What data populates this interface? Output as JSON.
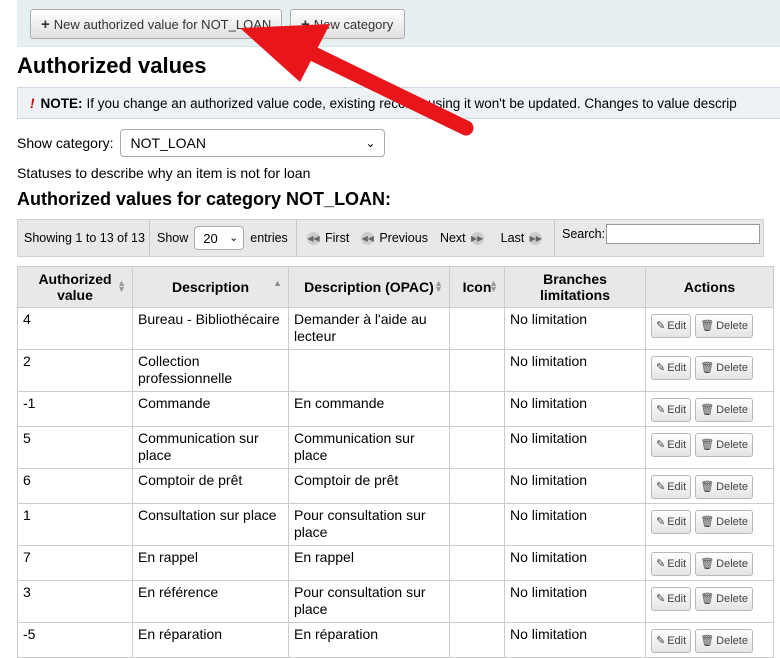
{
  "toolbar": {
    "new_value_label": "New authorized value for NOT_LOAN",
    "new_category_label": "New category"
  },
  "page_title": "Authorized values",
  "note": {
    "prefix": "NOTE:",
    "text": "If you change an authorized value code, existing records using it won't be updated. Changes to value descrip"
  },
  "show_category": {
    "label": "Show category:",
    "value": "NOT_LOAN"
  },
  "category_description": "Statuses to describe why an item is not for loan",
  "section_title": "Authorized values for category NOT_LOAN:",
  "datatable": {
    "info": "Showing 1 to 13 of 13",
    "show_label": "Show",
    "page_length": "20",
    "entries_label": "entries",
    "first": "First",
    "previous": "Previous",
    "next": "Next",
    "last": "Last",
    "search_label": "Search:"
  },
  "columns": [
    "Authorized value",
    "Description",
    "Description (OPAC)",
    "Icon",
    "Branches limitations",
    "Actions"
  ],
  "action_labels": {
    "edit": "Edit",
    "delete": "Delete"
  },
  "rows": [
    {
      "code": "4",
      "desc": "Bureau - Bibliothécaire",
      "opac": "Demander à l'aide au lecteur",
      "branches": "No limitation"
    },
    {
      "code": "2",
      "desc": "Collection professionnelle",
      "opac": "",
      "branches": "No limitation"
    },
    {
      "code": "-1",
      "desc": "Commande",
      "opac": "En commande",
      "branches": "No limitation"
    },
    {
      "code": "5",
      "desc": "Communication sur place",
      "opac": "Communication sur place",
      "branches": "No limitation"
    },
    {
      "code": "6",
      "desc": "Comptoir de prêt",
      "opac": "Comptoir de prêt",
      "branches": "No limitation"
    },
    {
      "code": "1",
      "desc": "Consultation sur place",
      "opac": "Pour consultation sur place",
      "branches": "No limitation"
    },
    {
      "code": "7",
      "desc": "En rappel",
      "opac": "En rappel",
      "branches": "No limitation"
    },
    {
      "code": "3",
      "desc": "En référence",
      "opac": "Pour consultation sur place",
      "branches": "No limitation"
    },
    {
      "code": "-5",
      "desc": "En réparation",
      "opac": "En réparation",
      "branches": "No limitation"
    }
  ],
  "colors": {
    "annotation_arrow": "#e8161b",
    "toolbar_bg": "#e6f0f2",
    "header_bg": "#e8e8e8"
  }
}
